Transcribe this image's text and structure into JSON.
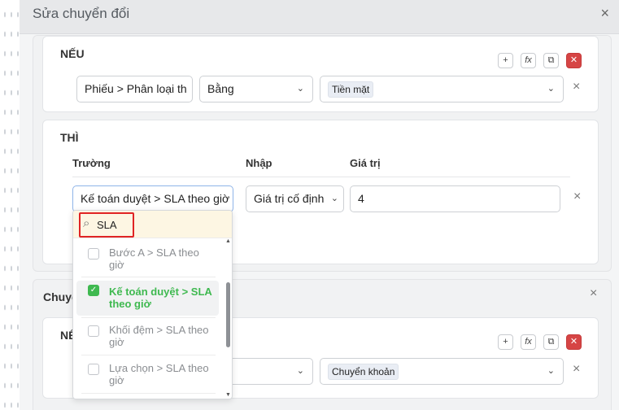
{
  "modal": {
    "title": "Sửa chuyển đổi",
    "close_icon": "×"
  },
  "rule1": {
    "if_title": "NẾU",
    "condition": {
      "field": "Phiếu > Phân loại th",
      "operator": "Bằng",
      "value_chip": "Tiền mặt"
    },
    "then_title": "THÌ",
    "columns": {
      "field": "Trường",
      "input": "Nhập",
      "value": "Giá trị"
    },
    "action": {
      "field": "Kế toán duyệt > SLA theo giờ",
      "input_type": "Giá trị cố định",
      "value": "4"
    }
  },
  "rule2": {
    "title_partial": "Chuyể",
    "if_title_partial": "NẾ",
    "value_chip": "Chuyển khoản"
  },
  "icons": {
    "add": "+",
    "fx": "fx",
    "copy": "⧉",
    "delete": "✕",
    "row_remove": "×",
    "chevron": "⌄",
    "search": "⌕",
    "check": "✓"
  },
  "dropdown": {
    "search_value": "SLA",
    "items": [
      {
        "label": "Bước A > SLA theo giờ",
        "selected": false
      },
      {
        "label": "Kế toán duyệt > SLA theo giờ",
        "selected": true
      },
      {
        "label": "Khối đệm > SLA theo giờ",
        "selected": false
      },
      {
        "label": "Lựa chọn > SLA theo giờ",
        "selected": false
      }
    ]
  },
  "colors": {
    "accent_green": "#3fb950",
    "danger": "#d64545",
    "highlight_red": "#e02424"
  }
}
